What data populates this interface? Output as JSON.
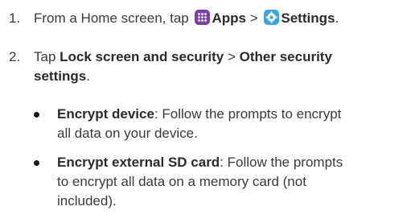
{
  "steps": [
    {
      "num": "1.",
      "pre": "From a Home screen, tap",
      "apps_label": "Apps",
      "sep": ">",
      "settings_label": "Settings",
      "end": "."
    },
    {
      "num": "2.",
      "pre": "Tap",
      "lock_label": "Lock screen and security",
      "sep": ">",
      "other_label_line1": "Other security",
      "other_label_line2": "settings",
      "end": "."
    }
  ],
  "bullets": [
    {
      "title": "Encrypt device",
      "line1": ": Follow the prompts to encrypt",
      "line2": "all data on your device."
    },
    {
      "title": "Encrypt external SD card",
      "line1": ": Follow the prompts",
      "line2": "to encrypt all data on a memory card (not",
      "line3": "included)."
    }
  ],
  "icons": {
    "apps": "apps-grid-icon",
    "settings": "settings-gear-icon",
    "apps_color": "#7b3fa6",
    "settings_color": "#3aa6e6"
  }
}
